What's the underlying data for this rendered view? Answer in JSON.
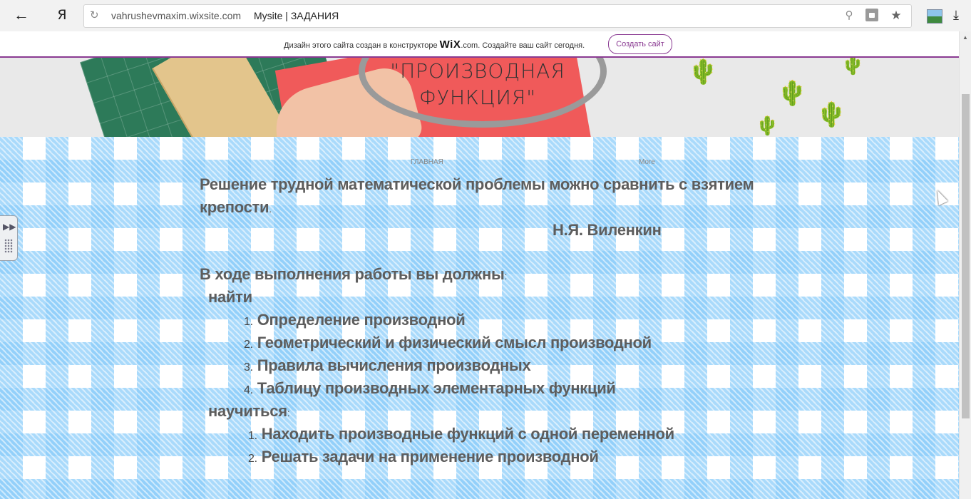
{
  "browser": {
    "url_domain": "vahrushevmaxim.wixsite.com",
    "page_title": "Mysite | ЗАДАНИЯ",
    "ya_label": "Я"
  },
  "promo": {
    "text_before": "Дизайн этого сайта создан в конструкторе",
    "brand": "WiX",
    "brand_suffix": ".com",
    "text_after": ". Создайте ваш сайт сегодня.",
    "button_label": "Создать сайт",
    "accent_color": "#8a3a92"
  },
  "hero": {
    "title_line1": "\"ПРОИЗВОДНАЯ",
    "title_line2": "ФУНКЦИЯ\""
  },
  "nav": {
    "home": "ГЛАВНАЯ",
    "more": "More"
  },
  "content": {
    "quote_line1": "Решение трудной математической проблемы можно сравнить с взятием",
    "quote_line2": "крепости",
    "quote_line2_end": ".",
    "author": "Н.Я. Виленкин",
    "intro": "В ходе выполнения работы вы должны",
    "intro_colon": ":",
    "find_label": "найти",
    "find_items": [
      {
        "num": "1.",
        "text": "Определение производной"
      },
      {
        "num": "2.",
        "text": "Геометрический и физический смысл производной"
      },
      {
        "num": "3.",
        "text": "Правила вычисления производных"
      },
      {
        "num": "4.",
        "text": "Таблицу производных элементарных функций"
      }
    ],
    "learn_label": "научиться",
    "learn_colon": ":",
    "learn_items": [
      {
        "num": "1.",
        "text": "Находить производные функций с одной переменной"
      },
      {
        "num": "2.",
        "text": "Решать задачи на применение производной"
      }
    ]
  }
}
